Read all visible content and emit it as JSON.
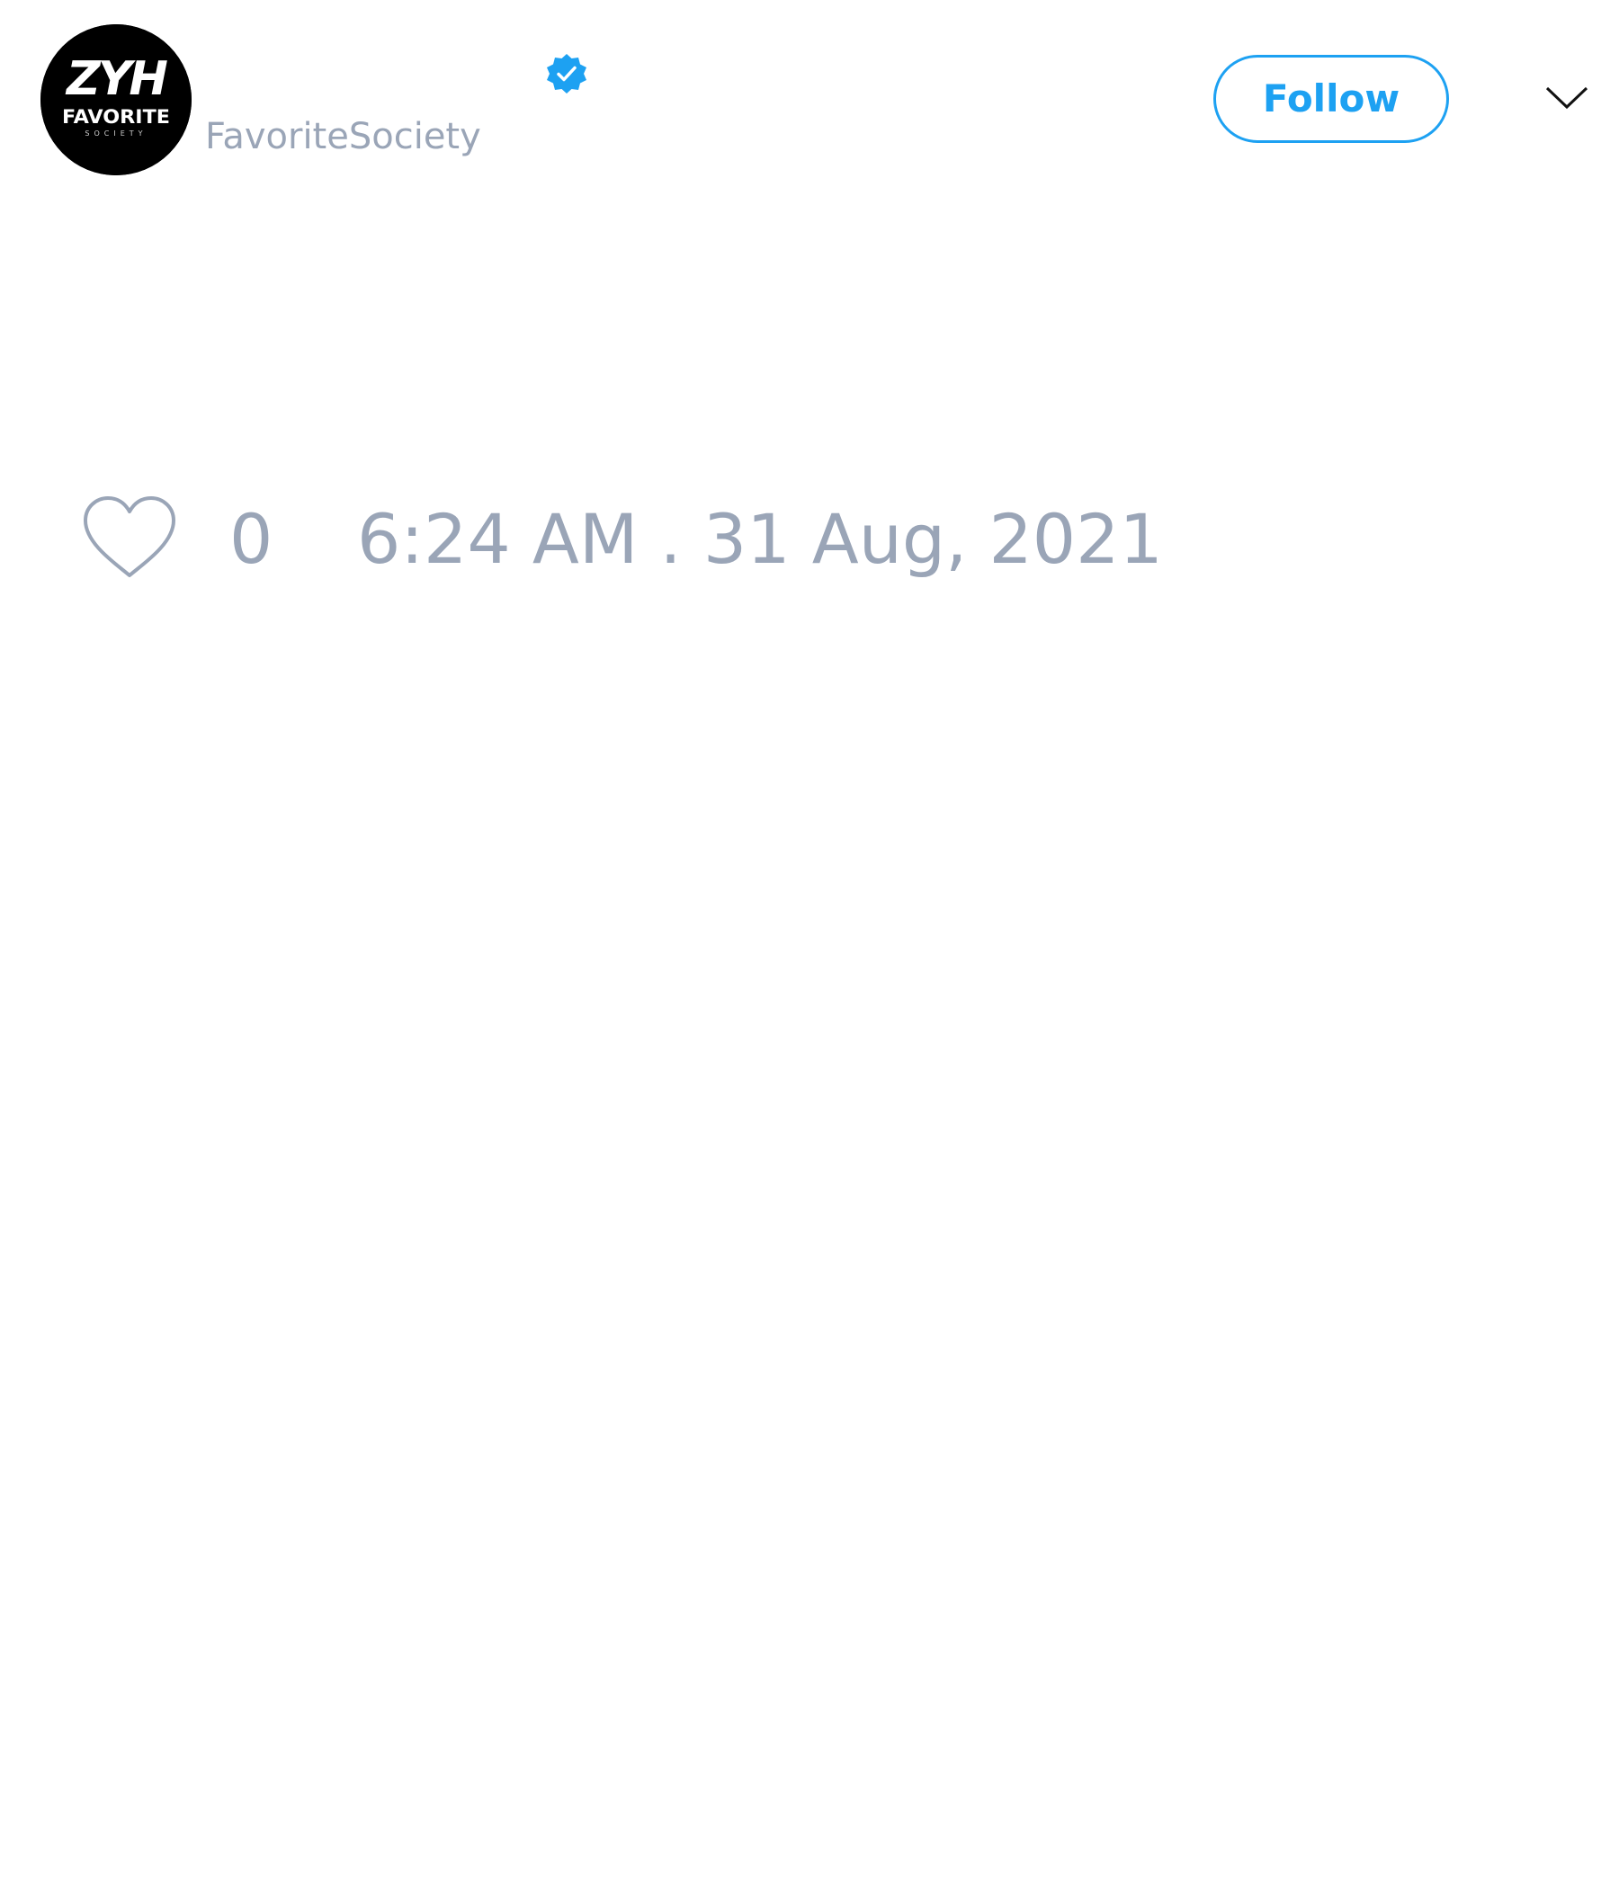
{
  "tweet": {
    "author": {
      "display_name": "",
      "handle": "FavoriteSociety",
      "verified": true,
      "avatar_icon": "zyh-favorite-society-logo",
      "avatar_text": {
        "line1": "ZYH",
        "line2": "FAVORITE",
        "line3": "SOCIETY"
      }
    },
    "follow_label": "Follow",
    "menu_icon": "chevron-down-icon",
    "like_icon": "heart-outline-icon",
    "like_count": "0",
    "timestamp": "6:24 AM . 31 Aug, 2021"
  },
  "colors": {
    "accent": "#1da1f2",
    "muted_text": "#9aa5b7",
    "avatar_bg": "#000000",
    "background": "#ffffff",
    "icon_stroke": "#9aa5b7",
    "chevron_stroke": "#111111"
  }
}
